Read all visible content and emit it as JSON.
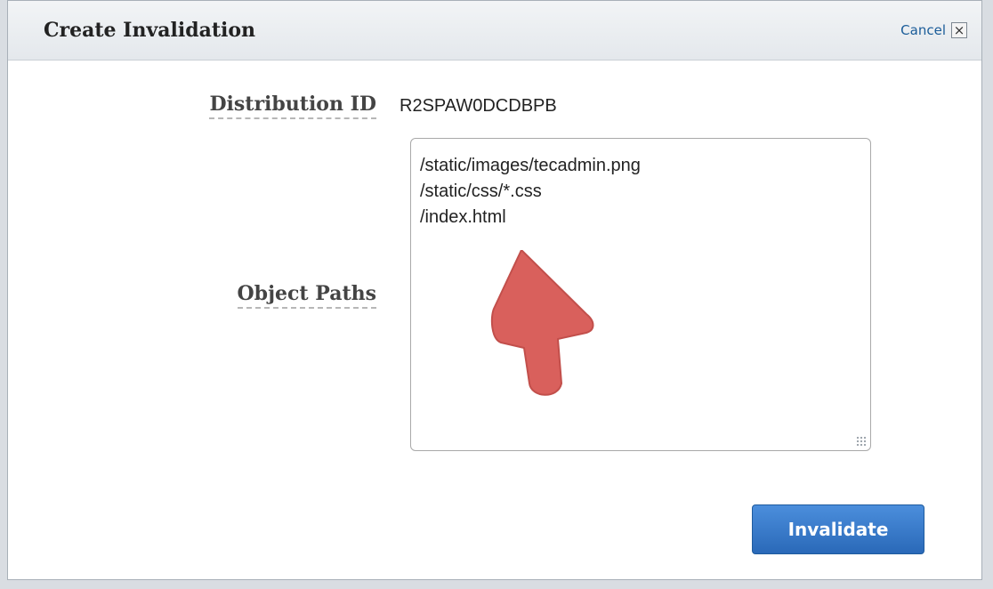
{
  "dialog": {
    "title": "Create Invalidation",
    "cancel_label": "Cancel",
    "close_glyph": "×"
  },
  "form": {
    "distribution_id_label": "Distribution ID",
    "distribution_id_value": "R2SPAW0DCDBPB",
    "object_paths_label": "Object Paths",
    "object_paths": [
      "/static/images/tecadmin.png",
      "/static/css/*.css",
      "/index.html"
    ]
  },
  "actions": {
    "invalidate_label": "Invalidate"
  },
  "colors": {
    "primary_button": "#2a69b8",
    "link": "#1a5c99",
    "annotation_arrow": "#d9605c"
  },
  "icons": {
    "close": "close-icon",
    "annotation": "annotation-arrow-icon"
  }
}
